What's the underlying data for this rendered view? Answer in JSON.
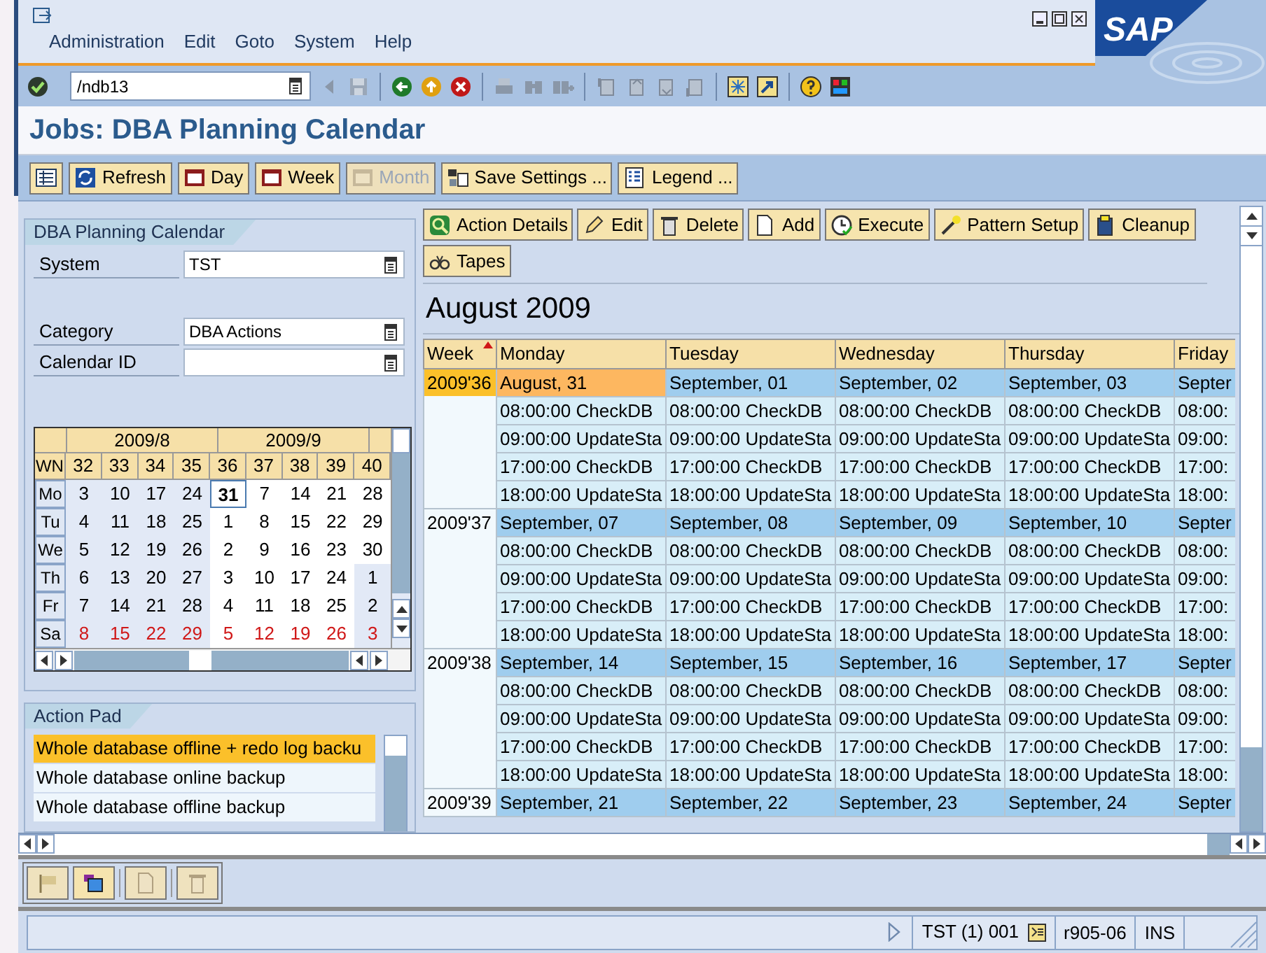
{
  "window": {
    "logo": "SAP"
  },
  "menu": [
    "Administration",
    "Edit",
    "Goto",
    "System",
    "Help"
  ],
  "command_field": {
    "value": "/ndb13"
  },
  "title": "Jobs: DBA Planning Calendar",
  "app_toolbar": [
    {
      "label": "Refresh",
      "disabled": false
    },
    {
      "label": "Day",
      "disabled": false
    },
    {
      "label": "Week",
      "disabled": false
    },
    {
      "label": "Month",
      "disabled": true
    },
    {
      "label": "Save Settings ...",
      "disabled": false
    },
    {
      "label": "Legend ...",
      "disabled": false
    }
  ],
  "left_panel": {
    "title": "DBA Planning Calendar",
    "fields": [
      {
        "label": "System",
        "value": "TST"
      },
      {
        "label": "Category",
        "value": "DBA Actions"
      },
      {
        "label": "Calendar ID"
      }
    ]
  },
  "mini_calendar": {
    "months": [
      "2009/8",
      "2009/9"
    ],
    "wn_label": "WN",
    "weeks": [
      "32",
      "33",
      "34",
      "35",
      "36",
      "37",
      "38",
      "39",
      "40"
    ],
    "rows": [
      {
        "label": "Mo",
        "weekend": false,
        "days": [
          {
            "d": "3",
            "current": false,
            "selected": false
          },
          {
            "d": "10",
            "current": false,
            "selected": false
          },
          {
            "d": "17",
            "current": false,
            "selected": false
          },
          {
            "d": "24",
            "current": false,
            "selected": false
          },
          {
            "d": "31",
            "current": true,
            "selected": true
          },
          {
            "d": "7",
            "current": true,
            "selected": false
          },
          {
            "d": "14",
            "current": true,
            "selected": false
          },
          {
            "d": "21",
            "current": true,
            "selected": false
          },
          {
            "d": "28",
            "current": true,
            "selected": false
          }
        ]
      },
      {
        "label": "Tu",
        "weekend": false,
        "days": [
          {
            "d": "4",
            "current": false,
            "selected": false
          },
          {
            "d": "11",
            "current": false,
            "selected": false
          },
          {
            "d": "18",
            "current": false,
            "selected": false
          },
          {
            "d": "25",
            "current": false,
            "selected": false
          },
          {
            "d": "1",
            "current": true,
            "selected": false
          },
          {
            "d": "8",
            "current": true,
            "selected": false
          },
          {
            "d": "15",
            "current": true,
            "selected": false
          },
          {
            "d": "22",
            "current": true,
            "selected": false
          },
          {
            "d": "29",
            "current": true,
            "selected": false
          }
        ]
      },
      {
        "label": "We",
        "weekend": false,
        "days": [
          {
            "d": "5",
            "current": false,
            "selected": false
          },
          {
            "d": "12",
            "current": false,
            "selected": false
          },
          {
            "d": "19",
            "current": false,
            "selected": false
          },
          {
            "d": "26",
            "current": false,
            "selected": false
          },
          {
            "d": "2",
            "current": true,
            "selected": false
          },
          {
            "d": "9",
            "current": true,
            "selected": false
          },
          {
            "d": "16",
            "current": true,
            "selected": false
          },
          {
            "d": "23",
            "current": true,
            "selected": false
          },
          {
            "d": "30",
            "current": true,
            "selected": false
          }
        ]
      },
      {
        "label": "Th",
        "weekend": false,
        "days": [
          {
            "d": "6",
            "current": false,
            "selected": false
          },
          {
            "d": "13",
            "current": false,
            "selected": false
          },
          {
            "d": "20",
            "current": false,
            "selected": false
          },
          {
            "d": "27",
            "current": false,
            "selected": false
          },
          {
            "d": "3",
            "current": true,
            "selected": false
          },
          {
            "d": "10",
            "current": true,
            "selected": false
          },
          {
            "d": "17",
            "current": true,
            "selected": false
          },
          {
            "d": "24",
            "current": true,
            "selected": false
          },
          {
            "d": "1",
            "current": false,
            "selected": false
          }
        ]
      },
      {
        "label": "Fr",
        "weekend": false,
        "days": [
          {
            "d": "7",
            "current": false,
            "selected": false
          },
          {
            "d": "14",
            "current": false,
            "selected": false
          },
          {
            "d": "21",
            "current": false,
            "selected": false
          },
          {
            "d": "28",
            "current": false,
            "selected": false
          },
          {
            "d": "4",
            "current": true,
            "selected": false
          },
          {
            "d": "11",
            "current": true,
            "selected": false
          },
          {
            "d": "18",
            "current": true,
            "selected": false
          },
          {
            "d": "25",
            "current": true,
            "selected": false
          },
          {
            "d": "2",
            "current": false,
            "selected": false
          }
        ]
      },
      {
        "label": "Sa",
        "weekend": true,
        "days": [
          {
            "d": "8",
            "current": false,
            "selected": false
          },
          {
            "d": "15",
            "current": false,
            "selected": false
          },
          {
            "d": "22",
            "current": false,
            "selected": false
          },
          {
            "d": "29",
            "current": false,
            "selected": false
          },
          {
            "d": "5",
            "current": true,
            "selected": false
          },
          {
            "d": "12",
            "current": true,
            "selected": false
          },
          {
            "d": "19",
            "current": true,
            "selected": false
          },
          {
            "d": "26",
            "current": true,
            "selected": false
          },
          {
            "d": "3",
            "current": false,
            "selected": false
          }
        ]
      }
    ]
  },
  "action_pad": {
    "title": "Action Pad",
    "items": [
      {
        "label": "Whole database offline + redo log backu",
        "selected": true
      },
      {
        "label": "Whole database online backup",
        "selected": false
      },
      {
        "label": "Whole database offline backup",
        "selected": false
      }
    ]
  },
  "calendar": {
    "buttons": [
      "Action Details",
      "Edit",
      "Delete",
      "Add",
      "Execute",
      "Pattern Setup",
      "Cleanup",
      "Tapes"
    ],
    "heading": "August 2009",
    "columns": [
      "Week",
      "Monday",
      "Tuesday",
      "Wednesday",
      "Thursday",
      "Friday"
    ],
    "weeks": [
      {
        "label": "2009'36",
        "selected": true,
        "days": [
          {
            "date": "August, 31",
            "selected": true,
            "entries": [
              "08:00:00 CheckDB",
              "09:00:00 UpdateSta",
              "17:00:00 CheckDB",
              "18:00:00 UpdateSta"
            ]
          },
          {
            "date": "September, 01",
            "selected": false,
            "entries": [
              "08:00:00 CheckDB",
              "09:00:00 UpdateSta",
              "17:00:00 CheckDB",
              "18:00:00 UpdateSta"
            ]
          },
          {
            "date": "September, 02",
            "selected": false,
            "entries": [
              "08:00:00 CheckDB",
              "09:00:00 UpdateSta",
              "17:00:00 CheckDB",
              "18:00:00 UpdateSta"
            ]
          },
          {
            "date": "September, 03",
            "selected": false,
            "entries": [
              "08:00:00 CheckDB",
              "09:00:00 UpdateSta",
              "17:00:00 CheckDB",
              "18:00:00 UpdateSta"
            ]
          },
          {
            "date": "Septer",
            "selected": false,
            "entries": [
              "08:00:",
              "09:00:",
              "17:00:",
              "18:00:"
            ]
          }
        ]
      },
      {
        "label": "2009'37",
        "selected": false,
        "days": [
          {
            "date": "September, 07",
            "selected": false,
            "entries": [
              "08:00:00 CheckDB",
              "09:00:00 UpdateSta",
              "17:00:00 CheckDB",
              "18:00:00 UpdateSta"
            ]
          },
          {
            "date": "September, 08",
            "selected": false,
            "entries": [
              "08:00:00 CheckDB",
              "09:00:00 UpdateSta",
              "17:00:00 CheckDB",
              "18:00:00 UpdateSta"
            ]
          },
          {
            "date": "September, 09",
            "selected": false,
            "entries": [
              "08:00:00 CheckDB",
              "09:00:00 UpdateSta",
              "17:00:00 CheckDB",
              "18:00:00 UpdateSta"
            ]
          },
          {
            "date": "September, 10",
            "selected": false,
            "entries": [
              "08:00:00 CheckDB",
              "09:00:00 UpdateSta",
              "17:00:00 CheckDB",
              "18:00:00 UpdateSta"
            ]
          },
          {
            "date": "Septer",
            "selected": false,
            "entries": [
              "08:00:",
              "09:00:",
              "17:00:",
              "18:00:"
            ]
          }
        ]
      },
      {
        "label": "2009'38",
        "selected": false,
        "days": [
          {
            "date": "September, 14",
            "selected": false,
            "entries": [
              "08:00:00 CheckDB",
              "09:00:00 UpdateSta",
              "17:00:00 CheckDB",
              "18:00:00 UpdateSta"
            ]
          },
          {
            "date": "September, 15",
            "selected": false,
            "entries": [
              "08:00:00 CheckDB",
              "09:00:00 UpdateSta",
              "17:00:00 CheckDB",
              "18:00:00 UpdateSta"
            ]
          },
          {
            "date": "September, 16",
            "selected": false,
            "entries": [
              "08:00:00 CheckDB",
              "09:00:00 UpdateSta",
              "17:00:00 CheckDB",
              "18:00:00 UpdateSta"
            ]
          },
          {
            "date": "September, 17",
            "selected": false,
            "entries": [
              "08:00:00 CheckDB",
              "09:00:00 UpdateSta",
              "17:00:00 CheckDB",
              "18:00:00 UpdateSta"
            ]
          },
          {
            "date": "Septer",
            "selected": false,
            "entries": [
              "08:00:",
              "09:00:",
              "17:00:",
              "18:00:"
            ]
          }
        ]
      },
      {
        "label": "2009'39",
        "selected": false,
        "days": [
          {
            "date": "September, 21",
            "selected": false
          },
          {
            "date": "September, 22",
            "selected": false
          },
          {
            "date": "September, 23",
            "selected": false
          },
          {
            "date": "September, 24",
            "selected": false
          },
          {
            "date": "Septer",
            "selected": false
          }
        ]
      }
    ]
  },
  "bottom_toolbar": [
    {
      "disabled": true
    },
    {
      "disabled": false
    },
    {
      "disabled": true
    },
    {
      "disabled": true
    }
  ],
  "status_bar": {
    "system": "TST (1) 001",
    "server": "r905-06",
    "mode": "INS"
  }
}
